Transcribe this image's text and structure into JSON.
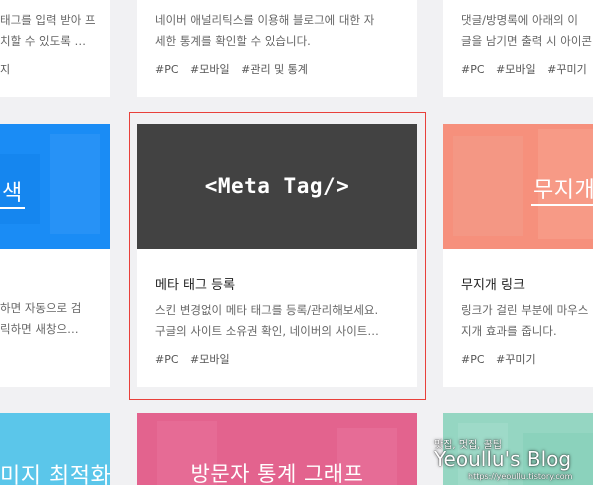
{
  "cards": {
    "top_left": {
      "desc": [
        "태그를 입력 받아 프",
        "치할 수 있도록 …"
      ],
      "tags": [
        "지"
      ]
    },
    "top_mid": {
      "desc": [
        "네이버 애널리틱스를 이용해 블로그에 대한 자",
        "세한 통계를 확인할 수 있습니다."
      ],
      "tags": [
        "#PC",
        "#모바일",
        "#관리 및 통계"
      ]
    },
    "top_right": {
      "desc": [
        "댓글/방명록에 아래의 이",
        "글을 남기면 출력 시 아이콘"
      ],
      "tags": [
        "#PC",
        "#모바일",
        "#꾸미기"
      ]
    },
    "mid_left": {
      "thumb_label": "색",
      "thumb_color": "#1a8cf5",
      "desc": [
        "하면 자동으로 검",
        "릭하면 새창으…"
      ]
    },
    "mid_center": {
      "thumb_label": "<Meta Tag/>",
      "thumb_color": "#424242",
      "title": "메타 태그 등록",
      "desc": [
        "스킨 변경없이 메타 태그를 등록/관리해보세요.",
        "구글의 사이트 소유권 확인, 네이버의 사이트…"
      ],
      "tags": [
        "#PC",
        "#모바일"
      ]
    },
    "mid_right": {
      "thumb_label": "무지개",
      "thumb_color": "#f6907c",
      "title": "무지개 링크",
      "desc": [
        "링크가 걸린 부분에 마우스",
        "지개 효과를 줍니다."
      ],
      "tags": [
        "#PC",
        "#꾸미기"
      ]
    },
    "bot_left": {
      "thumb_label": "미지 최적화",
      "thumb_color": "#5bc6ea"
    },
    "bot_mid": {
      "thumb_label": "방문자 통계 그래프",
      "thumb_color": "#e3638e"
    },
    "bot_right": {
      "thumb_color": "#95d6c2"
    }
  },
  "highlight_color": "#e8403a",
  "watermark": {
    "top": "맛집, 멋집, 꿀팁",
    "main": "Yeoullu's Blog",
    "url": "https://yeoullu.tistory.com"
  }
}
